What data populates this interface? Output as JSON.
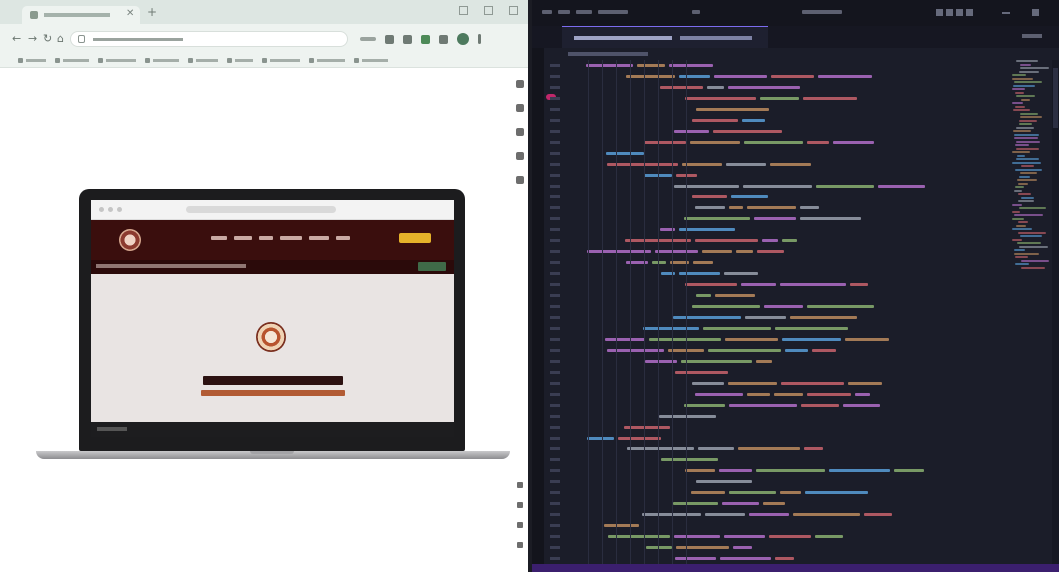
{
  "browser": {
    "tab_count": 1,
    "bookmark_count": 9
  },
  "editor": {
    "code_line_count": 46
  },
  "colors": {
    "browser_chrome": "#dde6e2",
    "site_header": "#3a0e0d",
    "site_cta": "#e5b22a",
    "site_hero": "#e9e4e3",
    "editor_bg": "#1b1d29",
    "editor_accent": "#7c6cf0",
    "keyword": "#c678dd",
    "tag": "#e06c75",
    "attr": "#d19a66",
    "string": "#98c379",
    "name": "#61afef",
    "plain": "#abb2bf"
  },
  "icons": {
    "nav": [
      "back-arrow-icon",
      "forward-arrow-icon",
      "reload-icon",
      "home-icon"
    ],
    "toolbar": [
      "extension-icon",
      "profile-icon",
      "menu-icon"
    ]
  }
}
